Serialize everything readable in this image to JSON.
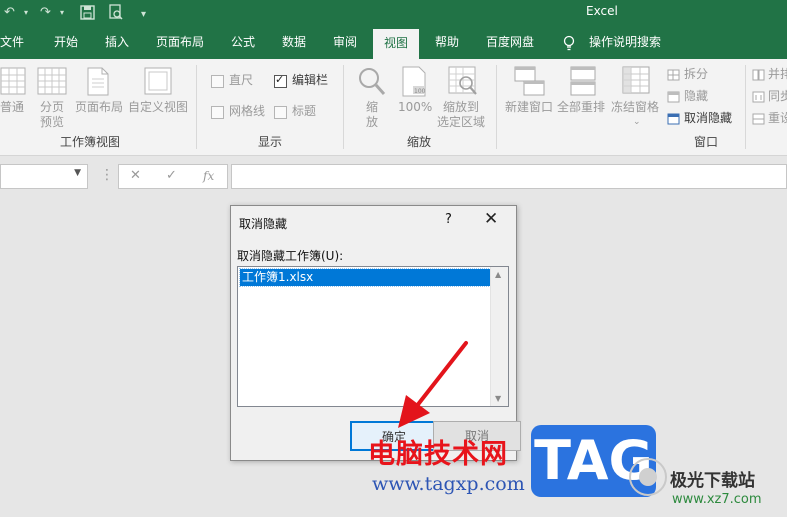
{
  "app": {
    "title": "Excel"
  },
  "colors": {
    "brand": "#217346",
    "selection": "#0078d7",
    "arrow": "#e3141b",
    "watermark_tag": "#2b73df"
  },
  "quick_access": {
    "undo": "↶",
    "redo": "↷",
    "save": "💾",
    "preview": "🖨",
    "customize": "▾"
  },
  "tabs": [
    {
      "label": "文件"
    },
    {
      "label": "开始"
    },
    {
      "label": "插入"
    },
    {
      "label": "页面布局"
    },
    {
      "label": "公式"
    },
    {
      "label": "数据"
    },
    {
      "label": "审阅"
    },
    {
      "label": "视图"
    },
    {
      "label": "帮助"
    },
    {
      "label": "百度网盘"
    },
    {
      "label": "操作说明搜索"
    }
  ],
  "active_tab": "视图",
  "ribbon": {
    "workbook_views": {
      "label": "工作簿视图",
      "normal": "普通",
      "page_break_1": "分页",
      "page_break_2": "预览",
      "page_layout": "页面布局",
      "custom_views": "自定义视图"
    },
    "show": {
      "label": "显示",
      "ruler": "直尺",
      "formula_bar": "编辑栏",
      "gridlines": "网格线",
      "headings": "标题",
      "formula_bar_checked": true
    },
    "zoom": {
      "label": "缩放",
      "zoom_1": "缩",
      "zoom_2": "放",
      "zoom_100": "100%",
      "zoom_selection_1": "缩放到",
      "zoom_selection_2": "选定区域"
    },
    "window": {
      "label": "窗口",
      "new_window": "新建窗口",
      "arrange_all": "全部重排",
      "freeze_panes": "冻结窗格",
      "split": "拆分",
      "hide": "隐藏",
      "unhide": "取消隐藏",
      "side_by_side": "并排",
      "sync_scroll": "同步",
      "reset_position": "重设"
    }
  },
  "formula_bar": {
    "cancel": "✕",
    "enter": "✓",
    "fx": "fx",
    "value": ""
  },
  "dialog": {
    "title": "取消隐藏",
    "help": "?",
    "close": "✕",
    "list_label": "取消隐藏工作簿(U):",
    "items": [
      {
        "label": "工作簿1.xlsx",
        "selected": true
      }
    ],
    "ok_label": "确定",
    "cancel_label": "取消"
  },
  "watermark": {
    "site_cn": "电脑技术网",
    "site_url": "www.tagxp.com",
    "tag": "TAG",
    "download_site": "极光下载站",
    "download_url": "www.xz7.com"
  }
}
